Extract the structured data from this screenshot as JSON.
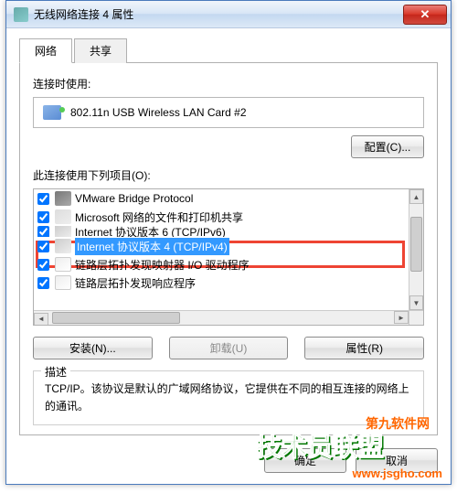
{
  "window": {
    "title": "无线网络连接 4 属性"
  },
  "tabs": {
    "network": "网络",
    "sharing": "共享"
  },
  "adapter": {
    "label": "连接时使用:",
    "name": "802.11n USB Wireless LAN Card #2",
    "configure_btn": "配置(C)..."
  },
  "items": {
    "label": "此连接使用下列项目(O):",
    "list": [
      {
        "label": "VMware Bridge Protocol"
      },
      {
        "label": "Microsoft 网络的文件和打印机共享"
      },
      {
        "label": "Internet 协议版本 6 (TCP/IPv6)"
      },
      {
        "label": "Internet 协议版本 4 (TCP/IPv4)"
      },
      {
        "label": "链路层拓扑发现映射器 I/O 驱动程序"
      },
      {
        "label": "链路层拓扑发现响应程序"
      }
    ]
  },
  "buttons": {
    "install": "安装(N)...",
    "uninstall": "卸载(U)",
    "properties": "属性(R)"
  },
  "description": {
    "title": "描述",
    "text": "TCP/IP。该协议是默认的广域网络协议，它提供在不同的相互连接的网络上的通讯。"
  },
  "bottom": {
    "ok": "确定",
    "cancel": "取消"
  },
  "watermarks": {
    "w1": "第九软件网",
    "w2": "技术员联盟",
    "w3": "www.jsgho.com"
  }
}
